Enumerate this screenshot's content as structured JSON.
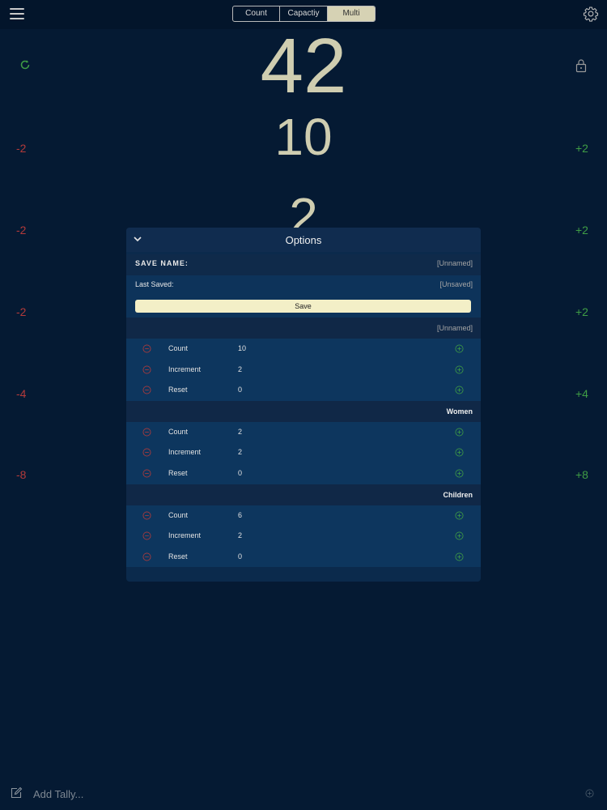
{
  "topbar": {
    "tabs": [
      {
        "label": "Count",
        "active": false
      },
      {
        "label": "Capactiy",
        "active": false
      },
      {
        "label": "Multi",
        "active": true
      }
    ]
  },
  "counters": {
    "total": "42",
    "row1": "10",
    "row2": "2"
  },
  "side_buttons": {
    "minus": [
      "-2",
      "-2",
      "-2",
      "-4",
      "-8"
    ],
    "plus": [
      "+2",
      "+2",
      "+2",
      "+4",
      "+8"
    ]
  },
  "options": {
    "title": "Options",
    "save_name_label": "SAVE NAME:",
    "save_name_value": "[Unnamed]",
    "last_saved_label": "Last Saved:",
    "last_saved_value": "[Unsaved]",
    "save_button": "Save",
    "groups": [
      {
        "name": "[Unnamed]",
        "items": [
          {
            "label": "Count",
            "value": "10"
          },
          {
            "label": "Increment",
            "value": "2"
          },
          {
            "label": "Reset",
            "value": "0"
          }
        ]
      },
      {
        "name": "Women",
        "items": [
          {
            "label": "Count",
            "value": "2"
          },
          {
            "label": "Increment",
            "value": "2"
          },
          {
            "label": "Reset",
            "value": "0"
          }
        ]
      },
      {
        "name": "Children",
        "items": [
          {
            "label": "Count",
            "value": "6"
          },
          {
            "label": "Increment",
            "value": "2"
          },
          {
            "label": "Reset",
            "value": "0"
          }
        ]
      }
    ]
  },
  "bottom": {
    "add_tally_placeholder": "Add Tally..."
  },
  "colors": {
    "background": "#051a33",
    "accent": "#cfcdb0",
    "minus": "#b33a3a",
    "plus": "#3f9d45",
    "save_button": "#f3efc7"
  }
}
